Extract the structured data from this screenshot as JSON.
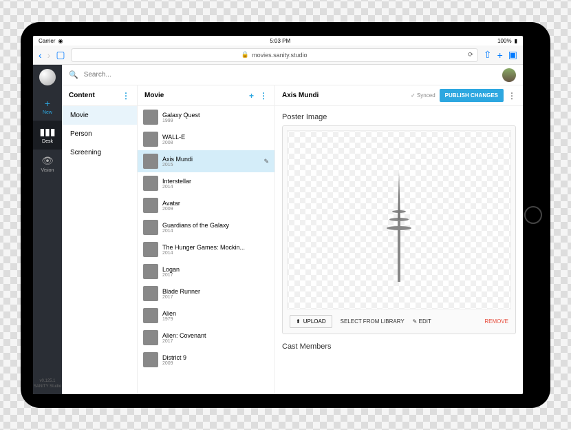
{
  "status": {
    "carrier": "Carrier",
    "wifi": "wifi-icon",
    "time": "5:03 PM",
    "battery": "100%"
  },
  "browser": {
    "url": "movies.sanity.studio",
    "lock": "lock-icon"
  },
  "search": {
    "placeholder": "Search..."
  },
  "sidebar": {
    "items": [
      {
        "icon": "+",
        "label": "New"
      },
      {
        "icon": "▮▮▮",
        "label": "Desk"
      },
      {
        "icon": "👁",
        "label": "Vision"
      }
    ],
    "footer_version": "v0.125.1",
    "footer_brand": "SANITY Studio"
  },
  "content_pane": {
    "title": "Content",
    "items": [
      "Movie",
      "Person",
      "Screening"
    ]
  },
  "movie_pane": {
    "title": "Movie",
    "items": [
      {
        "title": "Galaxy Quest",
        "year": "1999"
      },
      {
        "title": "WALL-E",
        "year": "2008"
      },
      {
        "title": "Axis Mundi",
        "year": "2015"
      },
      {
        "title": "Interstellar",
        "year": "2014"
      },
      {
        "title": "Avatar",
        "year": "2009"
      },
      {
        "title": "Guardians of the Galaxy",
        "year": "2014"
      },
      {
        "title": "The Hunger Games: Mockin...",
        "year": "2014"
      },
      {
        "title": "Logan",
        "year": "2017"
      },
      {
        "title": "Blade Runner",
        "year": "2017"
      },
      {
        "title": "Alien",
        "year": "1979"
      },
      {
        "title": "Alien: Covenant",
        "year": "2017"
      },
      {
        "title": "District 9",
        "year": "2009"
      }
    ]
  },
  "doc": {
    "title": "Axis Mundi",
    "sync": "✓ Synced",
    "publish": "PUBLISH CHANGES",
    "poster_label": "Poster Image",
    "upload": "UPLOAD",
    "select_lib": "SELECT FROM LIBRARY",
    "edit": "EDIT",
    "remove": "REMOVE",
    "cast_label": "Cast Members"
  }
}
